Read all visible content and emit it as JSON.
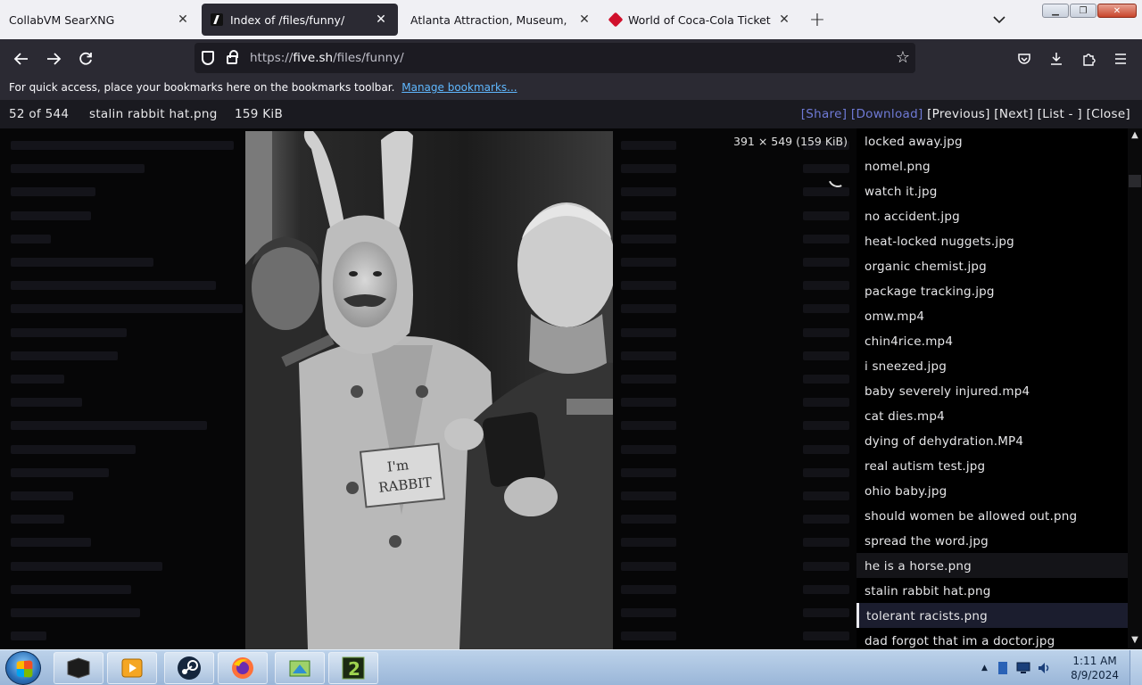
{
  "browser": {
    "tabs": [
      {
        "label": "CollabVM SearXNG",
        "active": false
      },
      {
        "label": "Index of /files/funny/",
        "active": true
      },
      {
        "label": "Atlanta Attraction, Museum, & Venu",
        "active": false
      },
      {
        "label": "World of Coca-Cola Ticketing S",
        "active": false
      }
    ],
    "new_tab_symbol": "+",
    "url_prefix": "https://",
    "url_domain": "five.sh",
    "url_path": "/files/funny/",
    "bookmarks_message": "For quick access, place your bookmarks here on the bookmarks toolbar.",
    "bookmarks_link": "Manage bookmarks..."
  },
  "viewer": {
    "position": "52 of 544",
    "filename": "stalin rabbit hat.png",
    "filesize": "159 KiB",
    "actions": {
      "share": "[Share]",
      "download": "[Download]",
      "previous": "[Previous]",
      "next": "[Next]",
      "list": "[List - ]",
      "close": "[Close]"
    },
    "dimensions": "391 × 549 (159 KiB)",
    "sign_text_1": "I'm",
    "sign_text_2": "RABBIT"
  },
  "file_list": [
    "locked away.jpg",
    "nomel.png",
    "watch it.jpg",
    "no accident.jpg",
    "heat-locked nuggets.jpg",
    "organic chemist.jpg",
    "package tracking.jpg",
    "omw.mp4",
    "chin4rice.mp4",
    "i sneezed.jpg",
    "baby severely injured.mp4",
    "cat dies.mp4",
    "dying of dehydration.MP4",
    "real autism test.jpg",
    "ohio baby.jpg",
    "should women be allowed out.png",
    "spread the word.jpg",
    "he is a horse.png",
    "stalin rabbit hat.png",
    "tolerant racists.png",
    "dad forgot that im a doctor.jpg"
  ],
  "file_list_current_index": 19,
  "file_list_hover_index": 17,
  "taskbar": {
    "time": "1:11 AM",
    "date": "8/9/2024"
  },
  "colors": {
    "accent_link": "#6f7ad6",
    "tab_active": "#2b2a33",
    "page_bg": "#060607"
  }
}
